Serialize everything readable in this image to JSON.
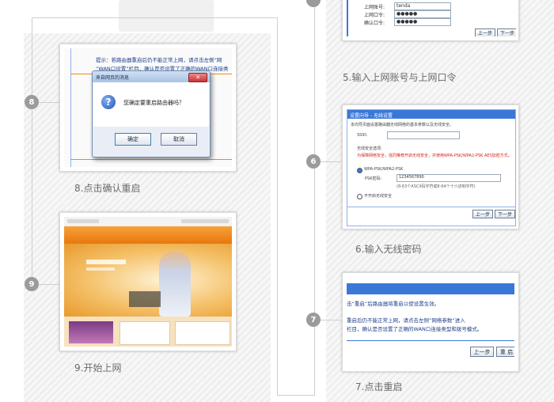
{
  "steps": {
    "s5": {
      "caption": "5.输入上网账号与上网口令"
    },
    "s6": {
      "number": "6",
      "caption": "6.输入无线密码",
      "header": "设置向导 - 无线设置",
      "desc": "本向导页面设置路由器无线网络的基本参数以及无线安全。",
      "ssid_label": "SSID:",
      "security_title": "无线安全选项:",
      "security_warning": "为保障网络安全，强烈推荐开启无线安全，并使用WPA-PSK/WPA2-PSK AES加密方式。",
      "option_wpa": "WPA-PSK/WPA2-PSK",
      "psk_label": "PSK密码:",
      "psk_value": "1234567890",
      "psk_hint": "(8-63个ASCII码字符或8-64个十六进制字符)",
      "option_none": "不开启无线安全",
      "prev": "上一步",
      "next": "下一步"
    },
    "s7": {
      "number": "7",
      "caption": "7.点击重启",
      "line1": "击“重启”后路由器将重启以使设置生效。",
      "line2": "重启后仍不能正常上网，请点击左侧“网络参数”进入",
      "line3": "栏目，确认是否设置了正确的WAN口连接类型和拨号模式。",
      "prev": "上一步",
      "reboot": "重 启"
    },
    "s8": {
      "number": "8",
      "caption": "8.点击确认重启",
      "hint_line1": "提示：若路由器重启后仍不能正常上网，请点击左侧“网",
      "hint_line2": "“WAN口设置”栏目，确认是否设置了正确的WAN口连接类",
      "dialog_title": "来自网页的消息",
      "dialog_message": "您确定要重启路由器吗？",
      "ok": "确定",
      "cancel": "取消"
    },
    "s9": {
      "number": "9",
      "caption": "9.开始上网"
    },
    "s5_form": {
      "account_label": "上网账号:",
      "account_value": "tenda",
      "password_label": "上网口令:",
      "confirm_label": "确认口令:",
      "password_mask": "●●●●●",
      "prev": "上一步",
      "next": "下一步"
    }
  },
  "colors": {
    "router_blue": "#3a78d8",
    "orange": "#f08a1a",
    "node_gray": "#9b9b9b"
  }
}
